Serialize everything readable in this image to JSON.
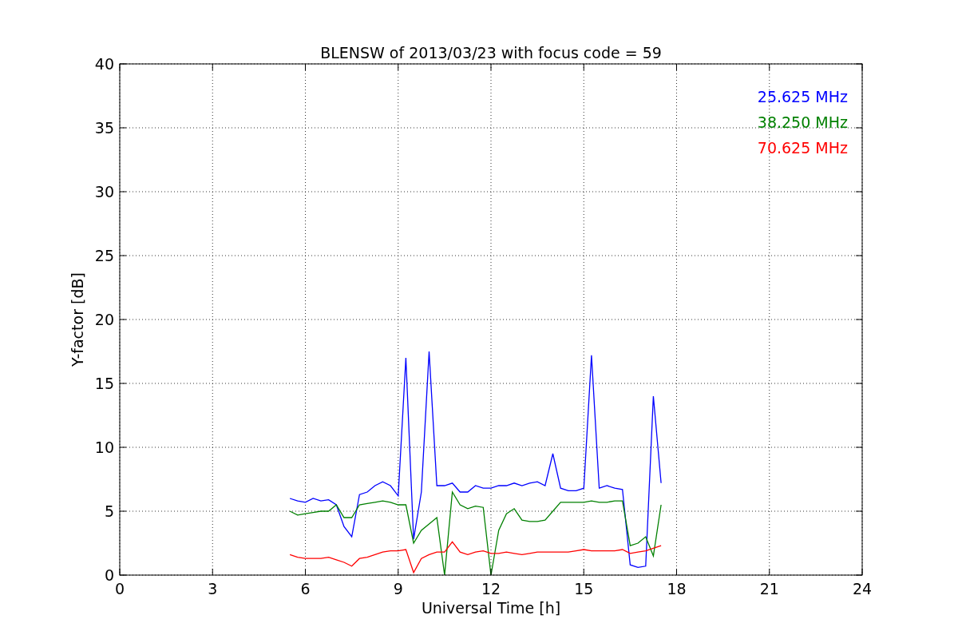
{
  "figure": {
    "chart_data": {
      "type": "line",
      "grid": true,
      "title": "BLENSW of 2013/03/23 with focus code = 59",
      "xlabel": "Universal Time [h]",
      "ylabel": "Y-factor [dB]",
      "xlim": [
        0,
        24
      ],
      "ylim": [
        0,
        40
      ],
      "xticks": [
        0,
        3,
        6,
        9,
        12,
        15,
        18,
        21,
        24
      ],
      "yticks": [
        0,
        5,
        10,
        15,
        20,
        25,
        30,
        35,
        40
      ],
      "x": [
        5.5,
        5.75,
        6,
        6.25,
        6.5,
        6.75,
        7,
        7.25,
        7.5,
        7.75,
        8,
        8.25,
        8.5,
        8.75,
        9,
        9.25,
        9.5,
        9.75,
        10,
        10.25,
        10.5,
        10.75,
        11,
        11.25,
        11.5,
        11.75,
        12,
        12.25,
        12.5,
        12.75,
        13,
        13.25,
        13.5,
        13.75,
        14,
        14.25,
        14.5,
        14.75,
        15,
        15.25,
        15.5,
        15.75,
        16,
        16.25,
        16.5,
        16.75,
        17,
        17.25,
        17.5
      ],
      "series": [
        {
          "name": "25.625 MHz",
          "color": "#0000ff",
          "values": [
            6,
            5.8,
            5.7,
            6,
            5.8,
            5.9,
            5.5,
            3.8,
            3,
            6.3,
            6.5,
            7,
            7.3,
            7,
            6.2,
            17,
            2.8,
            6.5,
            17.5,
            7,
            7,
            7.2,
            6.5,
            6.5,
            7,
            6.8,
            6.8,
            7,
            7,
            7.2,
            7,
            7.2,
            7.3,
            7,
            9.5,
            6.8,
            6.6,
            6.6,
            6.8,
            17.2,
            6.8,
            7,
            6.8,
            6.7,
            0.8,
            0.6,
            0.7,
            14,
            7.2
          ]
        },
        {
          "name": "38.250 MHz",
          "color": "#008000",
          "values": [
            5,
            4.7,
            4.8,
            4.9,
            5,
            5,
            5.5,
            4.5,
            4.5,
            5.5,
            5.6,
            5.7,
            5.8,
            5.7,
            5.5,
            5.5,
            2.5,
            3.5,
            4,
            4.5,
            0,
            6.5,
            5.5,
            5.2,
            5.4,
            5.3,
            0,
            3.5,
            4.8,
            5.2,
            4.3,
            4.2,
            4.2,
            4.3,
            5,
            5.7,
            5.7,
            5.7,
            5.7,
            5.8,
            5.7,
            5.7,
            5.8,
            5.8,
            2.3,
            2.5,
            3,
            1.5,
            5.5
          ]
        },
        {
          "name": "70.625 MHz",
          "color": "#ff0000",
          "values": [
            1.6,
            1.4,
            1.3,
            1.3,
            1.3,
            1.4,
            1.2,
            1,
            0.7,
            1.3,
            1.4,
            1.6,
            1.8,
            1.9,
            1.9,
            2,
            0.2,
            1.3,
            1.6,
            1.8,
            1.8,
            2.6,
            1.8,
            1.6,
            1.8,
            1.9,
            1.7,
            1.7,
            1.8,
            1.7,
            1.6,
            1.7,
            1.8,
            1.8,
            1.8,
            1.8,
            1.8,
            1.9,
            2,
            1.9,
            1.9,
            1.9,
            1.9,
            2,
            1.7,
            1.8,
            1.9,
            2.1,
            2.3
          ]
        }
      ]
    }
  }
}
